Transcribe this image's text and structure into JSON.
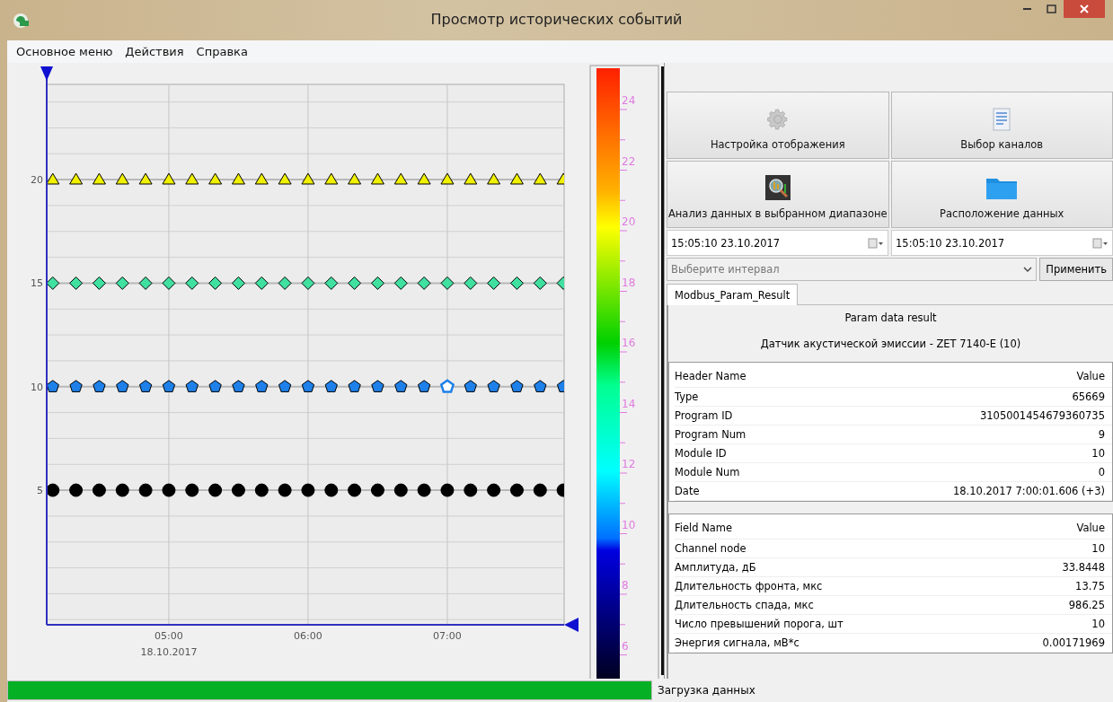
{
  "window": {
    "title": "Просмотр исторических событий"
  },
  "menu": [
    "Основное меню",
    "Действия",
    "Справка"
  ],
  "chart": {
    "chart_data": {
      "type": "scatter",
      "x": [
        4.1667,
        4.3333,
        4.5,
        4.6667,
        4.8333,
        5,
        5.1667,
        5.3333,
        5.5,
        5.6667,
        5.8333,
        6,
        6.1667,
        6.3333,
        6.5,
        6.6667,
        6.8333,
        7,
        7.1667,
        7.3333,
        7.5,
        7.6667,
        7.8333
      ],
      "series": [
        {
          "color": "#f0f000",
          "values": [
            20,
            20,
            20,
            20,
            20,
            20,
            20,
            20,
            20,
            20,
            20,
            20,
            20,
            20,
            20,
            20,
            20,
            20,
            20,
            20,
            20,
            20,
            20
          ]
        },
        {
          "color": "#40e0a0",
          "values": [
            15,
            15,
            15,
            15,
            15,
            15,
            15,
            15,
            15,
            15,
            15,
            15,
            15,
            15,
            15,
            15,
            15,
            15,
            15,
            15,
            15,
            15,
            15
          ]
        },
        {
          "color": "#1e80e8",
          "values": [
            10,
            10,
            10,
            10,
            10,
            10,
            10,
            10,
            10,
            10,
            10,
            10,
            10,
            10,
            10,
            10,
            10,
            10,
            10,
            10,
            10,
            10,
            10
          ]
        },
        {
          "color": "#000000",
          "values": [
            5,
            5,
            5,
            5,
            5,
            5,
            5,
            5,
            5,
            5,
            5,
            5,
            5,
            5,
            5,
            5,
            5,
            5,
            5,
            5,
            5,
            5,
            5
          ]
        }
      ],
      "xlim": [
        4.123,
        7.839
      ],
      "ylim": [
        -1.5,
        24.6
      ],
      "xticks": [
        {
          "value": 5,
          "label": "05:00"
        },
        {
          "value": 6,
          "label": "06:00"
        },
        {
          "value": 7,
          "label": "07:00"
        }
      ],
      "yticks": [
        5,
        10,
        15,
        20
      ],
      "grid": true
    },
    "markers": [
      {
        "kind": "triangle",
        "points": [
          {
            "selected": false
          },
          {
            "selected": false
          },
          {
            "selected": false
          },
          {
            "selected": false
          },
          {
            "selected": false
          },
          {
            "selected": false
          },
          {
            "selected": false
          },
          {
            "selected": false
          },
          {
            "selected": false
          },
          {
            "selected": false
          },
          {
            "selected": false
          },
          {
            "selected": false
          },
          {
            "selected": false
          },
          {
            "selected": false
          },
          {
            "selected": false
          },
          {
            "selected": false
          },
          {
            "selected": false
          },
          {
            "selected": false
          },
          {
            "selected": false
          },
          {
            "selected": false
          },
          {
            "selected": false
          },
          {
            "selected": false
          },
          {
            "selected": false
          }
        ]
      },
      {
        "kind": "diamond",
        "points": [
          {
            "selected": false
          },
          {
            "selected": false
          },
          {
            "selected": false
          },
          {
            "selected": false
          },
          {
            "selected": false
          },
          {
            "selected": false
          },
          {
            "selected": false
          },
          {
            "selected": false
          },
          {
            "selected": false
          },
          {
            "selected": false
          },
          {
            "selected": false
          },
          {
            "selected": false
          },
          {
            "selected": false
          },
          {
            "selected": false
          },
          {
            "selected": false
          },
          {
            "selected": false
          },
          {
            "selected": false
          },
          {
            "selected": false
          },
          {
            "selected": false
          },
          {
            "selected": false
          },
          {
            "selected": false
          },
          {
            "selected": false
          },
          {
            "selected": false
          }
        ]
      },
      {
        "kind": "pentagon",
        "points": [
          {
            "selected": false
          },
          {
            "selected": false
          },
          {
            "selected": false
          },
          {
            "selected": false
          },
          {
            "selected": false
          },
          {
            "selected": false
          },
          {
            "selected": false
          },
          {
            "selected": false
          },
          {
            "selected": false
          },
          {
            "selected": false
          },
          {
            "selected": false
          },
          {
            "selected": false
          },
          {
            "selected": false
          },
          {
            "selected": false
          },
          {
            "selected": false
          },
          {
            "selected": false
          },
          {
            "selected": false
          },
          {
            "selected": true
          },
          {
            "selected": false
          },
          {
            "selected": false
          },
          {
            "selected": false
          },
          {
            "selected": false
          },
          {
            "selected": false
          }
        ]
      },
      {
        "kind": "circle",
        "points": [
          {
            "selected": false
          },
          {
            "selected": false
          },
          {
            "selected": false
          },
          {
            "selected": false
          },
          {
            "selected": false
          },
          {
            "selected": false
          },
          {
            "selected": false
          },
          {
            "selected": false
          },
          {
            "selected": false
          },
          {
            "selected": false
          },
          {
            "selected": false
          },
          {
            "selected": false
          },
          {
            "selected": false
          },
          {
            "selected": false
          },
          {
            "selected": false
          },
          {
            "selected": false
          },
          {
            "selected": false
          },
          {
            "selected": false
          },
          {
            "selected": false
          },
          {
            "selected": false
          },
          {
            "selected": false
          },
          {
            "selected": false
          },
          {
            "selected": false
          }
        ]
      }
    ],
    "date_label": "18.10.2017"
  },
  "colorbar": {
    "labels": [
      "24",
      "22",
      "20",
      "18",
      "16",
      "14",
      "12",
      "10",
      "8",
      "6"
    ]
  },
  "buttons": [
    {
      "label": "Настройка отображения",
      "kind": "gear"
    },
    {
      "label": "Выбор каналов",
      "kind": "list"
    },
    {
      "label": "Анализ данных в выбранном диапазоне",
      "kind": "analysis"
    },
    {
      "label": "Расположение данных",
      "kind": "folder"
    }
  ],
  "date_from": "15:05:10 23.10.2017",
  "date_to": "15:05:10 23.10.2017",
  "interval": {
    "placeholder": "Выберите интервал"
  },
  "apply_button": "Применить",
  "tabs": [
    {
      "label": "Modbus_Param_Result",
      "selected": true
    }
  ],
  "result": {
    "title": "Param data result",
    "subtitle": "Датчик акустической эмиссии - ZET 7140-E (10)",
    "tables": [
      {
        "columns": [
          "Header Name",
          "Value"
        ],
        "rows": [
          [
            "Type",
            "65669"
          ],
          [
            "Program ID",
            "3105001454679360735"
          ],
          [
            "Program Num",
            "9"
          ],
          [
            "Module ID",
            "10"
          ],
          [
            "Module Num",
            "0"
          ],
          [
            "Date",
            "18.10.2017 7:00:01.606 (+3)"
          ]
        ]
      },
      {
        "columns": [
          "Field Name",
          "Value"
        ],
        "rows": [
          [
            "Channel node",
            "10"
          ],
          [
            "Амплитуда, дБ",
            "33.8448"
          ],
          [
            "Длительность фронта, мкс",
            "13.75"
          ],
          [
            "Длительность спада, мкс",
            "986.25"
          ],
          [
            "Число превышений порога, шт",
            "10"
          ],
          [
            "Энергия сигнала, мВ*с",
            "0.00171969"
          ]
        ]
      }
    ]
  },
  "status_bar": {
    "progress": {
      "level": 1
    },
    "text": "Загрузка данных"
  }
}
